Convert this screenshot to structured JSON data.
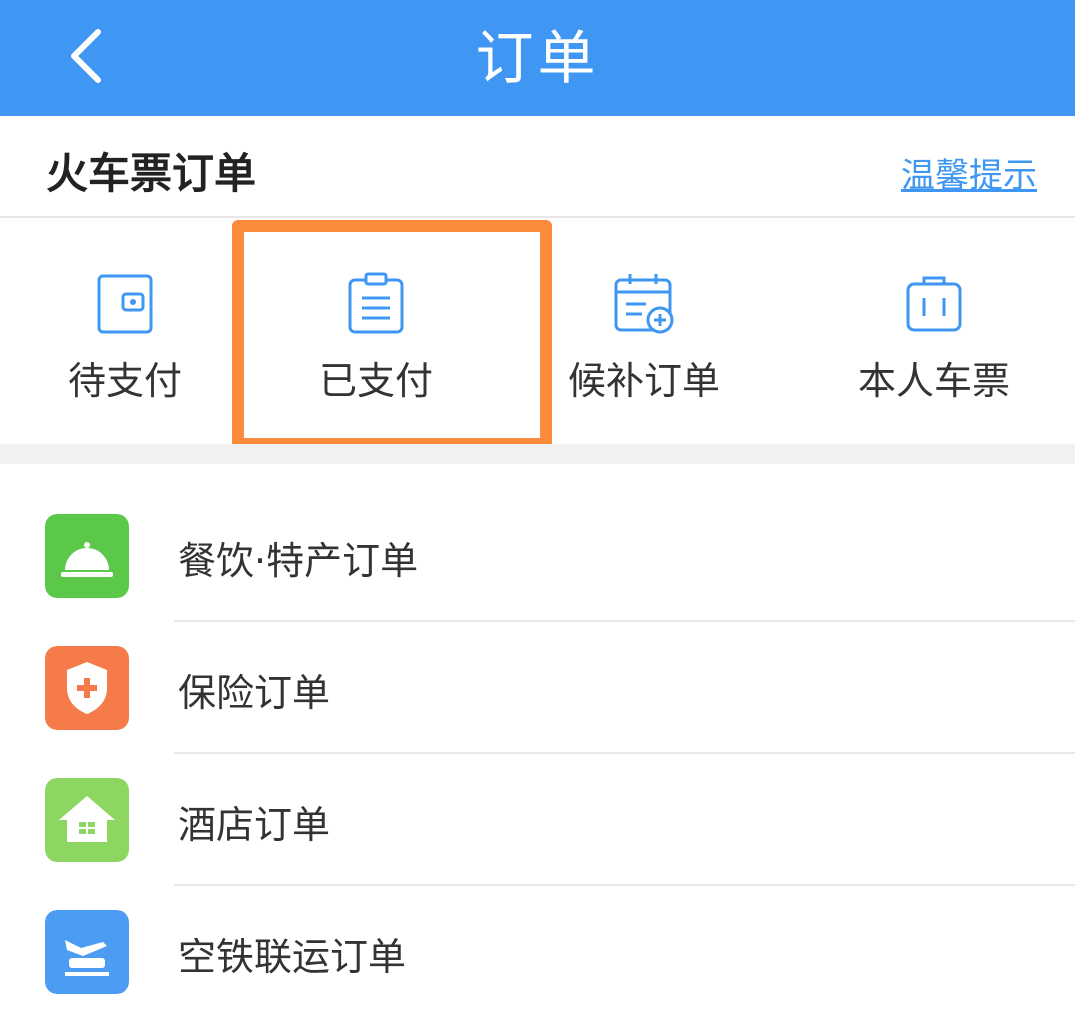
{
  "header": {
    "title": "订单",
    "back_icon": "chevron-left-icon",
    "background": "#3f97f3"
  },
  "section": {
    "title": "火车票订单",
    "tips_link": "温馨提示"
  },
  "tabs": [
    {
      "label": "待支付",
      "icon": "wallet-icon"
    },
    {
      "label": "已支付",
      "icon": "clipboard-icon",
      "highlighted": true
    },
    {
      "label": "候补订单",
      "icon": "calendar-add-icon"
    },
    {
      "label": "本人车票",
      "icon": "suitcase-icon"
    }
  ],
  "highlight_color": "#fb8c3c",
  "list": [
    {
      "label": "餐饮·特产订单",
      "icon": "service-bell-icon",
      "color": "#5cc84a"
    },
    {
      "label": "保险订单",
      "icon": "shield-plus-icon",
      "color": "#f57c4a"
    },
    {
      "label": "酒店订单",
      "icon": "hotel-house-icon",
      "color": "#8dd662"
    },
    {
      "label": "空铁联运订单",
      "icon": "plane-train-icon",
      "color": "#4c9cf3"
    }
  ]
}
